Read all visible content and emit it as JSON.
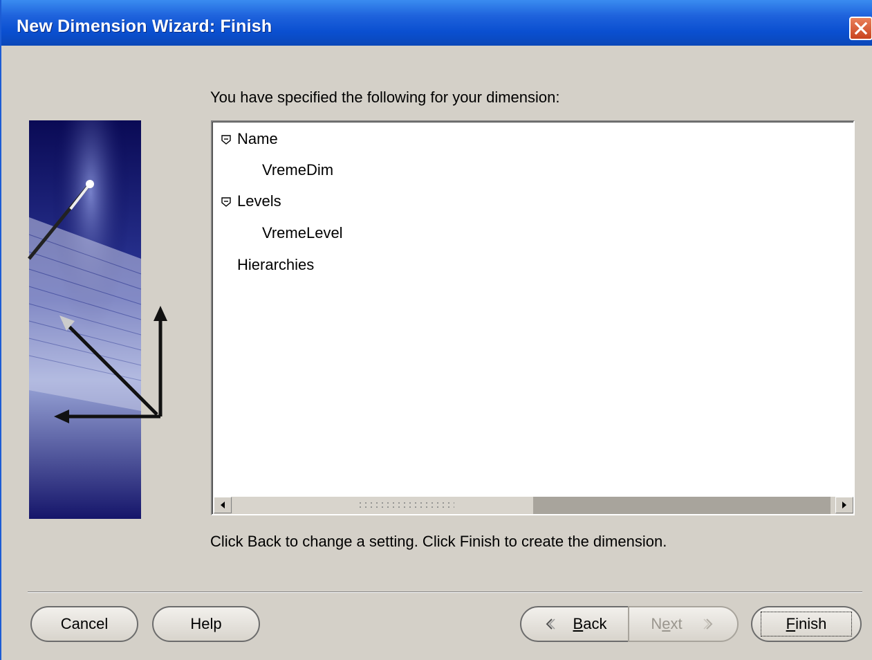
{
  "window": {
    "title": "New Dimension Wizard: Finish"
  },
  "intro": "You have specified the following for your dimension:",
  "tree": {
    "name_label": "Name",
    "name_value": "VremeDim",
    "levels_label": "Levels",
    "levels_value": "VremeLevel",
    "hierarchies_label": "Hierarchies"
  },
  "footer_text": "Click Back to change a setting.  Click Finish to create the dimension.",
  "buttons": {
    "cancel": "Cancel",
    "help": "Help",
    "back_mnemonic": "B",
    "back_rest": "ack",
    "next_first": "N",
    "next_mnemonic": "e",
    "next_rest": "xt",
    "finish_mnemonic": "F",
    "finish_rest": "inish"
  },
  "colors": {
    "titlebar": "#0a4fd0",
    "dialog_bg": "#d4d0c8",
    "art_bg": "#1a1a6e"
  },
  "icons": [
    "close-icon",
    "collapse-icon",
    "scroll-left-icon",
    "scroll-right-icon",
    "back-chevron-icon",
    "next-chevron-icon"
  ]
}
